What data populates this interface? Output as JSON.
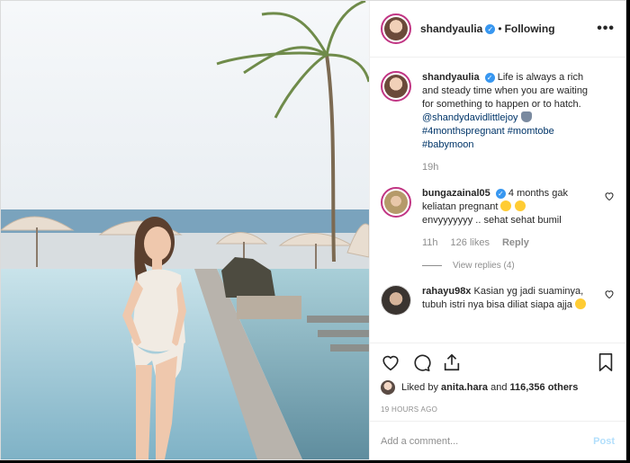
{
  "post": {
    "author": "shandyaulia",
    "follow_state": "Following",
    "separator": "•",
    "more": "•••"
  },
  "caption": {
    "username": "shandyaulia",
    "text": "Life is always a rich and steady time when you are waiting for something to happen or to hatch.",
    "mention": "@shandydavidlittlejoy",
    "hashtags": "#4monthspregnant #momtobe #babymoon",
    "time": "19h"
  },
  "comments": [
    {
      "username": "bungazainal05",
      "text_a": "4 months gak keliatan pregnant",
      "text_b": "envyyyyyyy .. sehat sehat bumil",
      "time": "11h",
      "likes": "126 likes",
      "reply": "Reply",
      "view_replies": "View replies (4)"
    },
    {
      "username": "rahayu98x",
      "text": "Kasian yg jadi suaminya, tubuh istri nya bisa diliat siapa ajja"
    }
  ],
  "likes": {
    "prefix": "Liked by",
    "user": "anita.hara",
    "middle": "and",
    "count": "116,356 others"
  },
  "timestamp": "19 HOURS AGO",
  "composer": {
    "placeholder": "Add a comment...",
    "post_label": "Post"
  },
  "colors": {
    "verified": "#3897f0",
    "hashtag": "#003569",
    "post_disabled": "#b2dffc"
  }
}
